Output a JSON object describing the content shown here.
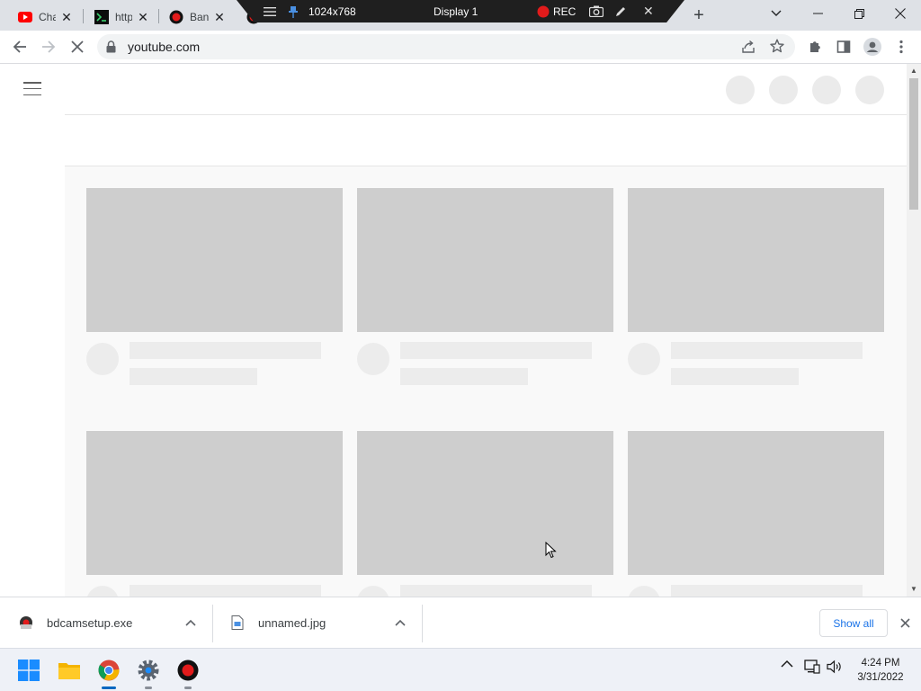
{
  "browser": {
    "tabs": [
      {
        "title": "Cha",
        "icon": "youtube-icon"
      },
      {
        "title": "http",
        "icon": "terminal-icon"
      },
      {
        "title": "Ban",
        "icon": "bandicam-icon"
      },
      {
        "title": "",
        "icon": "bandicam-icon"
      }
    ],
    "url": "youtube.com"
  },
  "recorder_bar": {
    "resolution": "1024x768",
    "display": "Display 1",
    "rec_label": "REC"
  },
  "youtube": {
    "state": "loading skeleton",
    "skeleton_cards": 6
  },
  "downloads": {
    "items": [
      {
        "name": "bdcamsetup.exe",
        "icon": "bandicam-installer-icon"
      },
      {
        "name": "unnamed.jpg",
        "icon": "image-file-icon"
      }
    ],
    "show_all_label": "Show all"
  },
  "taskbar": {
    "apps": [
      "windows-start-icon",
      "file-explorer-icon",
      "chrome-icon",
      "settings-icon",
      "bandicam-icon"
    ],
    "clock": {
      "time": "4:24 PM",
      "date": "3/31/2022"
    }
  },
  "colors": {
    "youtube_red": "#ff0000",
    "skeleton_gray": "#cecece",
    "accent_blue": "#1a73e8",
    "rec_red": "#e21b1b"
  }
}
